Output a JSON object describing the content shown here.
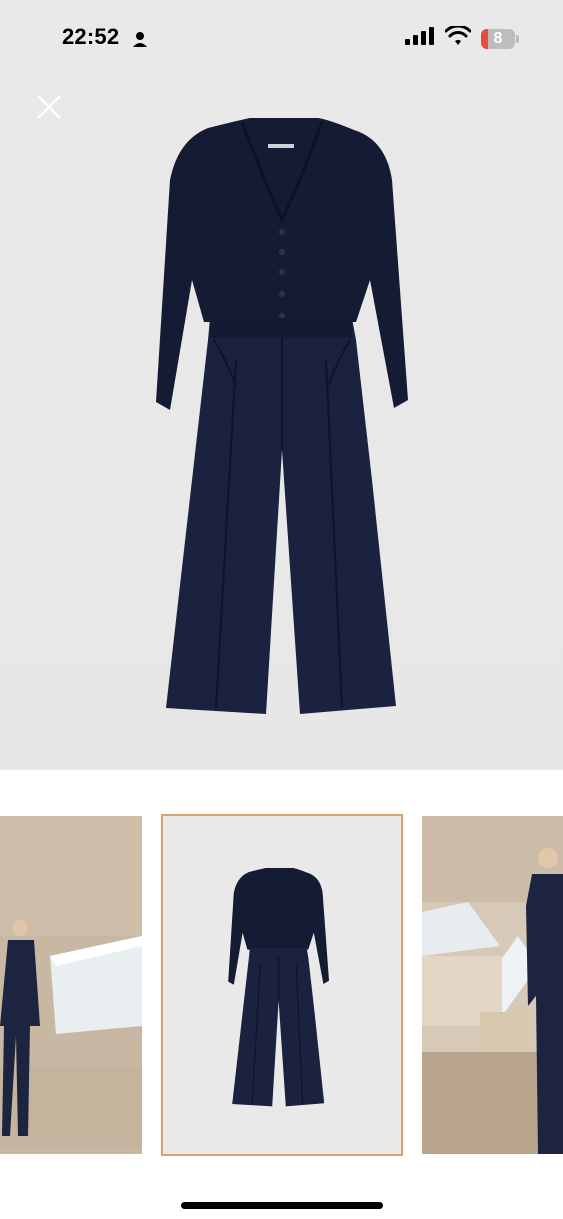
{
  "status_bar": {
    "time": "22:52",
    "battery_level": "8",
    "icons": [
      "person-icon",
      "cellular-signal-icon",
      "wifi-icon",
      "battery-icon"
    ]
  },
  "viewer": {
    "close_icon": "close-icon"
  },
  "thumbnails": {
    "items": [
      {
        "name": "lifestyle-photo-1",
        "selected": false
      },
      {
        "name": "product-flatlay-photo",
        "selected": true
      },
      {
        "name": "lifestyle-photo-2",
        "selected": false
      }
    ],
    "selected_border_color": "#d7a36c"
  },
  "colors": {
    "garment_navy": "#151b33",
    "background_grey": "#e9e9e9"
  }
}
